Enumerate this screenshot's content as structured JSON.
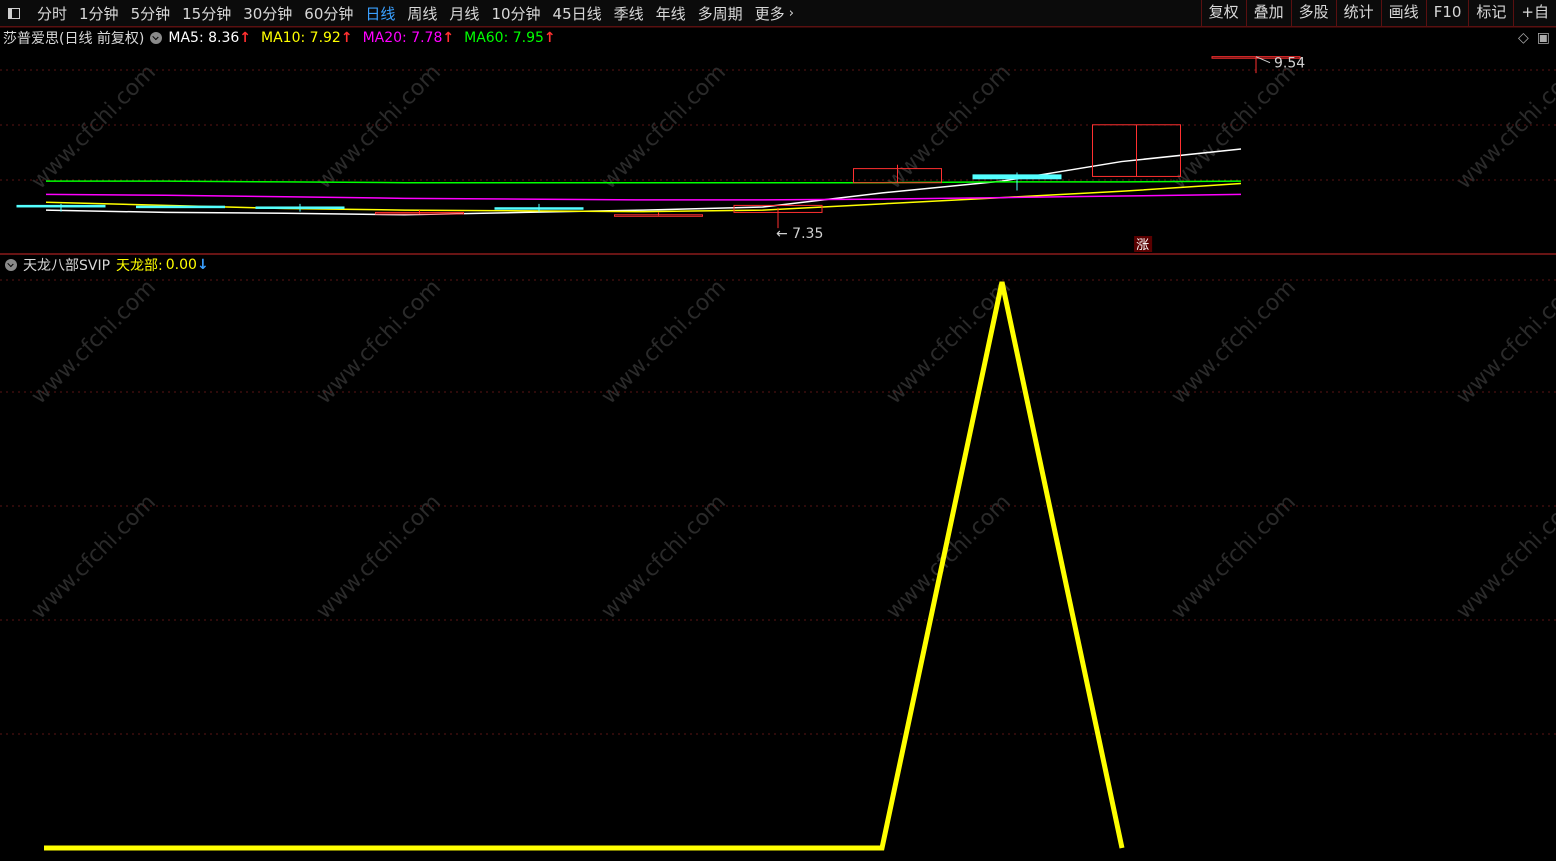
{
  "toolbar": {
    "periods": [
      {
        "label": "分时",
        "active": false
      },
      {
        "label": "1分钟",
        "active": false
      },
      {
        "label": "5分钟",
        "active": false
      },
      {
        "label": "15分钟",
        "active": false
      },
      {
        "label": "30分钟",
        "active": false
      },
      {
        "label": "60分钟",
        "active": false
      },
      {
        "label": "日线",
        "active": true
      },
      {
        "label": "周线",
        "active": false
      },
      {
        "label": "月线",
        "active": false
      },
      {
        "label": "10分钟",
        "active": false
      },
      {
        "label": "45日线",
        "active": false
      },
      {
        "label": "季线",
        "active": false
      },
      {
        "label": "年线",
        "active": false
      },
      {
        "label": "多周期",
        "active": false
      },
      {
        "label": "更多",
        "active": false
      }
    ],
    "tools": [
      "复权",
      "叠加",
      "多股",
      "统计",
      "画线",
      "F10",
      "标记",
      "+自"
    ]
  },
  "price_panel": {
    "stock_label": "莎普爱思(日线 前复权)",
    "ma": [
      {
        "label": "MA5:",
        "value": "8.36",
        "color": "#ffffff"
      },
      {
        "label": "MA10:",
        "value": "7.92",
        "color": "#ffff00"
      },
      {
        "label": "MA20:",
        "value": "7.78",
        "color": "#ff00ff"
      },
      {
        "label": "MA60:",
        "value": "7.95",
        "color": "#00ff00"
      }
    ],
    "high_label": "9.54",
    "low_label": "7.35",
    "limit_tag": "涨"
  },
  "indicator_panel": {
    "name": "天龙八部SVIP",
    "line_label": "天龙部:",
    "line_value": "0.00"
  },
  "watermark": "www.cfchi.com",
  "chart_data": [
    {
      "type": "candlestick",
      "ylim": [
        7.3,
        9.6
      ],
      "candles": [
        {
          "o": 7.64,
          "h": 7.66,
          "l": 7.56,
          "c": 7.62,
          "up": false
        },
        {
          "o": 7.63,
          "h": 7.63,
          "l": 7.61,
          "c": 7.62,
          "up": false
        },
        {
          "o": 7.62,
          "h": 7.66,
          "l": 7.56,
          "c": 7.62,
          "up": false
        },
        {
          "o": 7.55,
          "h": 7.58,
          "l": 7.53,
          "c": 7.55,
          "up": true
        },
        {
          "o": 7.61,
          "h": 7.66,
          "l": 7.56,
          "c": 7.6,
          "up": false
        },
        {
          "o": 7.52,
          "h": 7.55,
          "l": 7.51,
          "c": 7.52,
          "up": true
        },
        {
          "o": 7.55,
          "h": 7.61,
          "l": 7.35,
          "c": 7.64,
          "up": true
        },
        {
          "o": 7.93,
          "h": 8.16,
          "l": 7.93,
          "c": 8.11,
          "up": true
        },
        {
          "o": 7.98,
          "h": 8.06,
          "l": 7.83,
          "c": 8.03,
          "up": false
        },
        {
          "o": 8.01,
          "h": 8.67,
          "l": 8.01,
          "c": 8.67,
          "up": true
        },
        {
          "o": 9.54,
          "h": 9.54,
          "l": 9.33,
          "c": 9.54,
          "up": true
        }
      ],
      "series": [
        {
          "name": "MA5",
          "color": "#ffffff",
          "values": [
            7.58,
            7.55,
            7.54,
            7.52,
            7.55,
            7.58,
            7.62,
            7.8,
            7.95,
            8.2,
            8.36
          ]
        },
        {
          "name": "MA10",
          "color": "#ffff00",
          "values": [
            7.68,
            7.64,
            7.6,
            7.58,
            7.57,
            7.56,
            7.58,
            7.66,
            7.74,
            7.82,
            7.92
          ]
        },
        {
          "name": "MA20",
          "color": "#ff00ff",
          "values": [
            7.78,
            7.77,
            7.75,
            7.73,
            7.72,
            7.71,
            7.71,
            7.72,
            7.74,
            7.76,
            7.78
          ]
        },
        {
          "name": "MA60",
          "color": "#00ff00",
          "values": [
            7.95,
            7.95,
            7.94,
            7.93,
            7.93,
            7.93,
            7.93,
            7.93,
            7.94,
            7.94,
            7.95
          ]
        }
      ]
    },
    {
      "type": "line",
      "series": [
        {
          "name": "天龙部",
          "color": "#ffff00",
          "values": [
            0,
            0,
            0,
            0,
            0,
            0,
            0,
            0,
            1,
            0
          ]
        }
      ],
      "ylim": [
        0,
        1
      ]
    }
  ]
}
